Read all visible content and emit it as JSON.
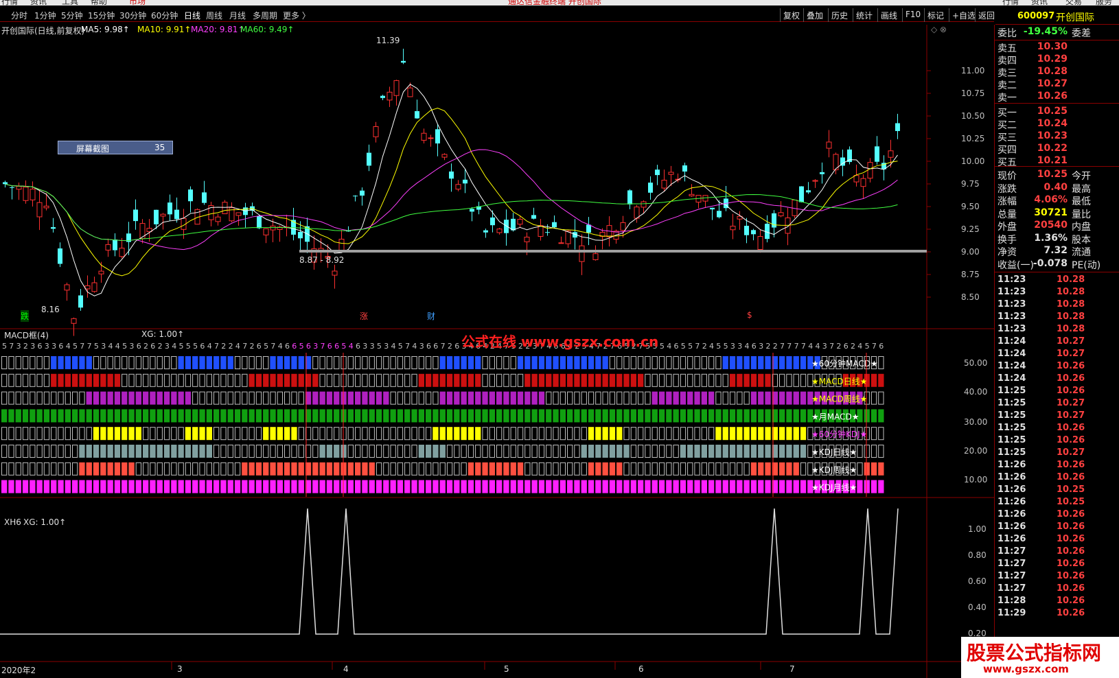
{
  "menubar": {
    "items": [
      "行情",
      "资讯",
      "工具",
      "帮助",
      "市场"
    ],
    "title": "通达信金融终端 开创国际",
    "right": [
      "行情",
      "资讯",
      "交易",
      "服务"
    ]
  },
  "periods": [
    "分时",
    "1分钟",
    "5分钟",
    "15分钟",
    "30分钟",
    "60分钟",
    "日线",
    "周线",
    "月线",
    "多周期",
    "更多 〉"
  ],
  "active_period": "日线",
  "tools": [
    "复权",
    "叠加",
    "历史",
    "统计",
    "画线",
    "F10",
    "标记",
    "+自选",
    "返回"
  ],
  "stock": {
    "code": "600097",
    "name": "开创国际"
  },
  "main_legend": {
    "title": "开创国际(日线,前复权)",
    "ma": [
      {
        "label": "MA5: 9.98↑",
        "color": "#ffffff"
      },
      {
        "label": "MA10: 9.91↑",
        "color": "#ffff00"
      },
      {
        "label": "MA20: 9.81↑",
        "color": "#ff40ff"
      },
      {
        "label": "MA60: 9.49↑",
        "color": "#40ff40"
      }
    ]
  },
  "annotations": {
    "high": "11.39",
    "low": "8.16",
    "range": "8.87 - 8.92",
    "signal_die": "跌",
    "signal_zhang": "涨",
    "signal_cai": "财",
    "signal_s": "$",
    "screenshot_box": "屏幕截图",
    "screenshot_num": "35",
    "site": "公式在线  www.gszx.com.cn"
  },
  "price_axis": [
    "11.00",
    "10.75",
    "10.50",
    "10.25",
    "10.00",
    "9.75",
    "9.50",
    "9.25",
    "9.00",
    "8.75",
    "8.50"
  ],
  "macd_panel": {
    "title": "MACD框(4)",
    "xg": "XG: 1.00↑",
    "axis": [
      "50.00",
      "40.00",
      "30.00",
      "20.00",
      "10.00"
    ],
    "rows": [
      {
        "label": "★60分钟MACD★",
        "color": "#2050ff",
        "text_color": "#ffffff"
      },
      {
        "label": "★MACD日线★",
        "color": "#cc1010",
        "text_color": "#ffff00"
      },
      {
        "label": "★MACD周线★",
        "color": "#b020c0",
        "text_color": "#ffff00"
      },
      {
        "label": "★月MACD★",
        "color": "#10a010",
        "text_color": "#ffffff"
      },
      {
        "label": "★60分钟KDJ★",
        "color": "#ffff00",
        "text_color": "#ff40ff"
      },
      {
        "label": "★KDJ日线★",
        "color": "#80a0a0",
        "text_color": "#ffffff"
      },
      {
        "label": "★KDJ周线★",
        "color": "#ff5040",
        "text_color": "#ffffff"
      },
      {
        "label": "★KDJ月线★",
        "color": "#ff20ff",
        "text_color": "#ffffff"
      }
    ]
  },
  "xh6_panel": {
    "title": "XH6",
    "xg": "XG: 1.00↑",
    "axis": [
      "1.00",
      "0.80",
      "0.60",
      "0.40",
      "0.20"
    ]
  },
  "date_axis": [
    "2020年2",
    "3",
    "4",
    "5",
    "6",
    "7"
  ],
  "quote": {
    "weibi_label": "委比",
    "weibi": "-19.45%",
    "weicha_label": "委差",
    "asks": [
      {
        "label": "卖五",
        "price": "10.30"
      },
      {
        "label": "卖四",
        "price": "10.29"
      },
      {
        "label": "卖三",
        "price": "10.28"
      },
      {
        "label": "卖二",
        "price": "10.27"
      },
      {
        "label": "卖一",
        "price": "10.26"
      }
    ],
    "bids": [
      {
        "label": "买一",
        "price": "10.25"
      },
      {
        "label": "买二",
        "price": "10.24"
      },
      {
        "label": "买三",
        "price": "10.23"
      },
      {
        "label": "买四",
        "price": "10.22"
      },
      {
        "label": "买五",
        "price": "10.21"
      }
    ],
    "stats": [
      {
        "label": "现价",
        "value": "10.25",
        "label2": "今开",
        "color": "#ff4040"
      },
      {
        "label": "涨跌",
        "value": "0.40",
        "label2": "最高",
        "color": "#ff4040"
      },
      {
        "label": "涨幅",
        "value": "4.06%",
        "label2": "最低",
        "color": "#ff4040"
      },
      {
        "label": "总量",
        "value": "30721",
        "label2": "量比",
        "color": "#ffff00"
      },
      {
        "label": "外盘",
        "value": "20540",
        "label2": "内盘",
        "color": "#ff4040"
      },
      {
        "label": "换手",
        "value": "1.36%",
        "label2": "股本",
        "color": "#e0e0e0"
      },
      {
        "label": "净资",
        "value": "7.32",
        "label2": "流通",
        "color": "#e0e0e0"
      },
      {
        "label": "收益(一)",
        "value": "-0.078",
        "label2": "PE(动)",
        "color": "#e0e0e0"
      }
    ],
    "ticks": [
      {
        "t": "11:23",
        "p": "10.28"
      },
      {
        "t": "11:23",
        "p": "10.28"
      },
      {
        "t": "11:23",
        "p": "10.28"
      },
      {
        "t": "11:23",
        "p": "10.28"
      },
      {
        "t": "11:23",
        "p": "10.28"
      },
      {
        "t": "11:24",
        "p": "10.27"
      },
      {
        "t": "11:24",
        "p": "10.27"
      },
      {
        "t": "11:24",
        "p": "10.26"
      },
      {
        "t": "11:24",
        "p": "10.26"
      },
      {
        "t": "11:25",
        "p": "10.26"
      },
      {
        "t": "11:25",
        "p": "10.27"
      },
      {
        "t": "11:25",
        "p": "10.27"
      },
      {
        "t": "11:25",
        "p": "10.26"
      },
      {
        "t": "11:25",
        "p": "10.26"
      },
      {
        "t": "11:25",
        "p": "10.27"
      },
      {
        "t": "11:26",
        "p": "10.26"
      },
      {
        "t": "11:26",
        "p": "10.26"
      },
      {
        "t": "11:26",
        "p": "10.25"
      },
      {
        "t": "11:26",
        "p": "10.25"
      },
      {
        "t": "11:26",
        "p": "10.26"
      },
      {
        "t": "11:26",
        "p": "10.26"
      },
      {
        "t": "11:26",
        "p": "10.26"
      },
      {
        "t": "11:27",
        "p": "10.26"
      },
      {
        "t": "11:27",
        "p": "10.26"
      },
      {
        "t": "11:27",
        "p": "10.26"
      },
      {
        "t": "11:27",
        "p": "10.26"
      },
      {
        "t": "11:28",
        "p": "10.26"
      },
      {
        "t": "11:29",
        "p": "10.26"
      }
    ]
  },
  "watermark": {
    "line1": "股票公式指标网",
    "line2": "www.gszx.com"
  },
  "chart_data": {
    "type": "candlestick",
    "title": "开创国际(日线,前复权)",
    "ylim": [
      8.25,
      11.5
    ],
    "ma_last": {
      "MA5": 9.98,
      "MA10": 9.91,
      "MA20": 9.81,
      "MA60": 9.49
    },
    "high": 11.39,
    "low": 8.16,
    "xh6_signals": [
      0.0,
      0.0,
      1.0,
      0.0,
      1.0,
      0.0,
      0.0,
      1.0,
      0.0,
      1.0,
      1.0
    ]
  }
}
